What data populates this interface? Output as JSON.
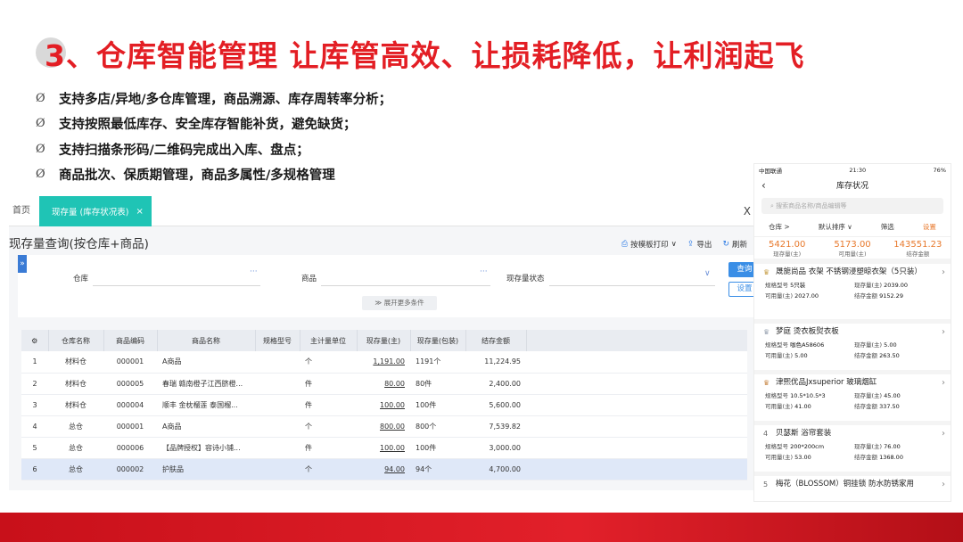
{
  "slide": {
    "title": "3、仓库智能管理  让库管高效、让损耗降低，让利润起飞",
    "bullet_mark": "Ø",
    "bullets": [
      "支持多店/异地/多仓库管理，商品溯源、库存周转率分析；",
      "支持按照最低库存、安全库存智能补货，避免缺货；",
      "支持扫描条形码/二维码完成出入库、盘点；",
      "商品批次、保质期管理，商品多属性/多规格管理"
    ],
    "colors": {
      "title": "#e31e24",
      "band": "#d8161f"
    }
  },
  "app": {
    "tabs": {
      "home": "首页",
      "active": "现存量 (库存状况表)",
      "close": "×"
    },
    "window_close": "X",
    "section_title": "现存量查询(按仓库+商品)",
    "actions": {
      "print": "按模板打印",
      "print_chevron": "∨",
      "export": "导出",
      "refresh": "刷新"
    },
    "filters": {
      "collapse": "»",
      "warehouse_label": "仓库",
      "product_label": "商品",
      "status_label": "现存量状态",
      "dots": "···",
      "chevron": "∨",
      "query": "查询",
      "setup": "设置",
      "expand_more": "≫ 展开更多条件"
    },
    "table": {
      "settings_icon": "⚙",
      "headers": [
        "仓库名称",
        "商品编码",
        "商品名称",
        "规格型号",
        "主计量单位",
        "现存量(主)",
        "现存量(包装)",
        "结存金额"
      ],
      "rows": [
        {
          "idx": "1",
          "warehouse": "材料仓",
          "code": "000001",
          "name": "A商品",
          "spec": "",
          "unit": "个",
          "qty_main": "1,191.00",
          "qty_pack": "1191个",
          "amount": "11,224.95"
        },
        {
          "idx": "2",
          "warehouse": "材料仓",
          "code": "000005",
          "name": "春瑞 赣南橙子江西脐橙...",
          "spec": "",
          "unit": "件",
          "qty_main": "80.00",
          "qty_pack": "80件",
          "amount": "2,400.00"
        },
        {
          "idx": "3",
          "warehouse": "材料仓",
          "code": "000004",
          "name": "顺丰 金枕榴莲 泰国榴...",
          "spec": "",
          "unit": "件",
          "qty_main": "100.00",
          "qty_pack": "100件",
          "amount": "5,600.00"
        },
        {
          "idx": "4",
          "warehouse": "总仓",
          "code": "000001",
          "name": "A商品",
          "spec": "",
          "unit": "个",
          "qty_main": "800.00",
          "qty_pack": "800个",
          "amount": "7,539.82"
        },
        {
          "idx": "5",
          "warehouse": "总仓",
          "code": "000006",
          "name": "【品牌授权】容诗小铺...",
          "spec": "",
          "unit": "件",
          "qty_main": "100.00",
          "qty_pack": "100件",
          "amount": "3,000.00"
        },
        {
          "idx": "6",
          "warehouse": "总仓",
          "code": "000002",
          "name": "护肤品",
          "spec": "",
          "unit": "个",
          "qty_main": "94.00",
          "qty_pack": "94个",
          "amount": "4,700.00"
        }
      ]
    }
  },
  "phone": {
    "status": {
      "carrier": "中国联通",
      "time": "21:30",
      "battery": "76%"
    },
    "title": "库存状况",
    "back": "‹",
    "search_placeholder": "搜索商品名称/商品编辑等",
    "filters": [
      "仓库 >",
      "默认排序 ∨",
      "筛选",
      "设置"
    ],
    "stats": [
      {
        "value": "5421.00",
        "label": "现存量(主)"
      },
      {
        "value": "5173.00",
        "label": "可用量(主)"
      },
      {
        "value": "143551.23",
        "label": "结存金额"
      }
    ],
    "labels": {
      "spec": "规格型号",
      "stock": "现存量(主)",
      "avail": "可用量(主)",
      "amount": "结存金额"
    },
    "items": [
      {
        "rank": "1",
        "name": "晟旎尚品 衣架 不锈钢浸塑晾衣架（5只装）",
        "spec": "5只装",
        "stock": "2039.00",
        "avail": "2027.00",
        "amount": "9152.29"
      },
      {
        "rank": "2",
        "name": "梦庭 烫衣板熨衣板",
        "spec": "咖色A58606",
        "stock": "5.00",
        "avail": "5.00",
        "amount": "263.50"
      },
      {
        "rank": "3",
        "name": "津熙优品Jxsuperior 玻璃烟缸",
        "spec": "10.5*10.5*3",
        "stock": "45.00",
        "avail": "41.00",
        "amount": "337.50"
      },
      {
        "rank": "4",
        "name": "贝瑟斯 浴帘套装",
        "spec": "200*200cm",
        "stock": "76.00",
        "avail": "53.00",
        "amount": "1368.00"
      },
      {
        "rank": "5",
        "name": "梅花（BLOSSOM）铜挂锁 防水防锈家用",
        "spec": "",
        "stock": "",
        "avail": "",
        "amount": ""
      }
    ]
  }
}
